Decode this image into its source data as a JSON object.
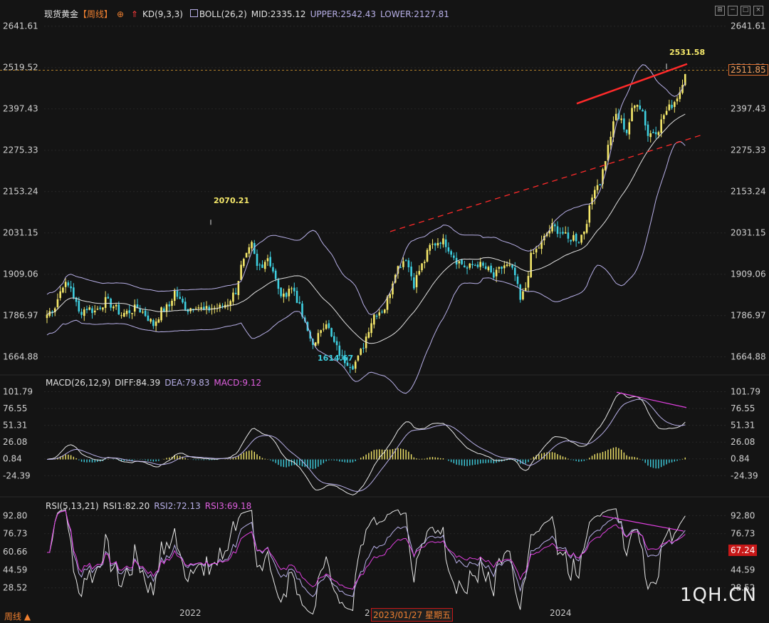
{
  "header": {
    "instrument": "现货黄金",
    "period": "【周线】",
    "kd_label": "KD(9,3,3)",
    "boll_label": "BOLL(26,2)",
    "mid": "MID:2335.12",
    "upper": "UPPER:2542.43",
    "lower": "LOWER:2127.81"
  },
  "macd_header": {
    "label": "MACD(26,12,9)",
    "diff": "DIFF:84.39",
    "dea": "DEA:79.83",
    "macd": "MACD:9.12"
  },
  "rsi_header": {
    "label": "RSI(5,13,21)",
    "rsi1": "RSI1:82.20",
    "rsi2": "RSI2:72.13",
    "rsi3": "RSI3:69.18"
  },
  "footer": {
    "period_label": "周线",
    "year_2022": "2022",
    "year_2023_partial": "2",
    "crosshair_date": "2023/01/27",
    "weekday": "星期五",
    "year_2024": "2024",
    "watermark": "1QH.CN"
  },
  "current_price_badge": "2511.85",
  "rsi_badge": "67.24",
  "colors": {
    "background": "#141414",
    "up_candle": "#f5e86a",
    "down_candle": "#3ecfe0",
    "boll_band": "#b8b0e8",
    "boll_mid": "#e0e0e0",
    "trendline": "#ff2a2a",
    "divergence": "#e040e0",
    "high_label": "#f5e86a",
    "low_label": "#3ecfe0"
  },
  "chart_data": [
    {
      "type": "candlestick",
      "title": "现货黄金 周线",
      "y_ticks": [
        2641.61,
        2519.52,
        2397.43,
        2275.33,
        2153.24,
        2031.15,
        1909.06,
        1786.97,
        1664.88
      ],
      "ylim": [
        1620,
        2660
      ],
      "x_year_labels": [
        "2022",
        "2024"
      ],
      "annotations": [
        {
          "text": "2070.21",
          "kind": "high"
        },
        {
          "text": "1614.67",
          "kind": "low"
        },
        {
          "text": "2531.58",
          "kind": "high"
        }
      ],
      "close_path": [
        [
          0,
          1790
        ],
        [
          3,
          1815
        ],
        [
          6,
          1880
        ],
        [
          9,
          1870
        ],
        [
          12,
          1795
        ],
        [
          15,
          1810
        ],
        [
          18,
          1800
        ],
        [
          22,
          1830
        ],
        [
          25,
          1815
        ],
        [
          28,
          1790
        ],
        [
          31,
          1800
        ],
        [
          34,
          1810
        ],
        [
          37,
          1790
        ],
        [
          40,
          1760
        ],
        [
          43,
          1800
        ],
        [
          46,
          1815
        ],
        [
          48,
          1860
        ],
        [
          50,
          1830
        ],
        [
          53,
          1805
        ],
        [
          56,
          1820
        ],
        [
          59,
          1800
        ],
        [
          62,
          1810
        ],
        [
          65,
          1810
        ],
        [
          68,
          1825
        ],
        [
          71,
          1860
        ],
        [
          73,
          1930
        ],
        [
          75,
          1960
        ],
        [
          77,
          1995
        ],
        [
          79,
          1930
        ],
        [
          81,
          1940
        ],
        [
          83,
          1960
        ],
        [
          85,
          1920
        ],
        [
          87,
          1860
        ],
        [
          89,
          1840
        ],
        [
          91,
          1870
        ],
        [
          93,
          1860
        ],
        [
          95,
          1810
        ],
        [
          97,
          1760
        ],
        [
          99,
          1720
        ],
        [
          101,
          1700
        ],
        [
          103,
          1750
        ],
        [
          105,
          1770
        ],
        [
          107,
          1720
        ],
        [
          109,
          1690
        ],
        [
          111,
          1660
        ],
        [
          113,
          1650
        ],
        [
          115,
          1640
        ],
        [
          117,
          1660
        ],
        [
          119,
          1700
        ],
        [
          121,
          1750
        ],
        [
          123,
          1790
        ],
        [
          125,
          1800
        ],
        [
          127,
          1810
        ],
        [
          129,
          1860
        ],
        [
          131,
          1920
        ],
        [
          133,
          1940
        ],
        [
          135,
          1960
        ],
        [
          136,
          1930
        ],
        [
          138,
          1880
        ],
        [
          140,
          1920
        ],
        [
          142,
          1950
        ],
        [
          144,
          1990
        ],
        [
          146,
          2000
        ],
        [
          148,
          2010
        ],
        [
          150,
          2000
        ],
        [
          152,
          1975
        ],
        [
          154,
          1950
        ],
        [
          156,
          1940
        ],
        [
          158,
          1925
        ],
        [
          160,
          1935
        ],
        [
          162,
          1940
        ],
        [
          164,
          1930
        ],
        [
          166,
          1920
        ],
        [
          168,
          1900
        ],
        [
          170,
          1920
        ],
        [
          172,
          1935
        ],
        [
          174,
          1930
        ],
        [
          176,
          1905
        ],
        [
          178,
          1830
        ],
        [
          180,
          1870
        ],
        [
          182,
          1960
        ],
        [
          184,
          1980
        ],
        [
          186,
          2000
        ],
        [
          188,
          2030
        ],
        [
          190,
          2050
        ],
        [
          192,
          2040
        ],
        [
          194,
          2030
        ],
        [
          196,
          2010
        ],
        [
          198,
          2020
        ],
        [
          200,
          2010
        ],
        [
          202,
          2040
        ],
        [
          204,
          2100
        ],
        [
          206,
          2170
        ],
        [
          208,
          2180
        ],
        [
          210,
          2250
        ],
        [
          212,
          2320
        ],
        [
          214,
          2380
        ],
        [
          216,
          2360
        ],
        [
          218,
          2330
        ],
        [
          220,
          2390
        ],
        [
          222,
          2420
        ],
        [
          224,
          2390
        ],
        [
          226,
          2320
        ],
        [
          228,
          2330
        ],
        [
          230,
          2340
        ],
        [
          232,
          2380
        ],
        [
          234,
          2400
        ],
        [
          236,
          2420
        ],
        [
          238,
          2450
        ],
        [
          240,
          2510
        ]
      ]
    },
    {
      "type": "bar",
      "title": "MACD(26,12,9)",
      "y_ticks": [
        101.79,
        76.55,
        51.31,
        26.08,
        0.84,
        -24.39
      ],
      "ylim": [
        -38,
        112
      ]
    },
    {
      "type": "line",
      "title": "RSI(5,13,21)",
      "y_ticks": [
        92.8,
        76.73,
        60.66,
        44.59,
        28.52
      ],
      "ylim": [
        20,
        100
      ]
    }
  ]
}
